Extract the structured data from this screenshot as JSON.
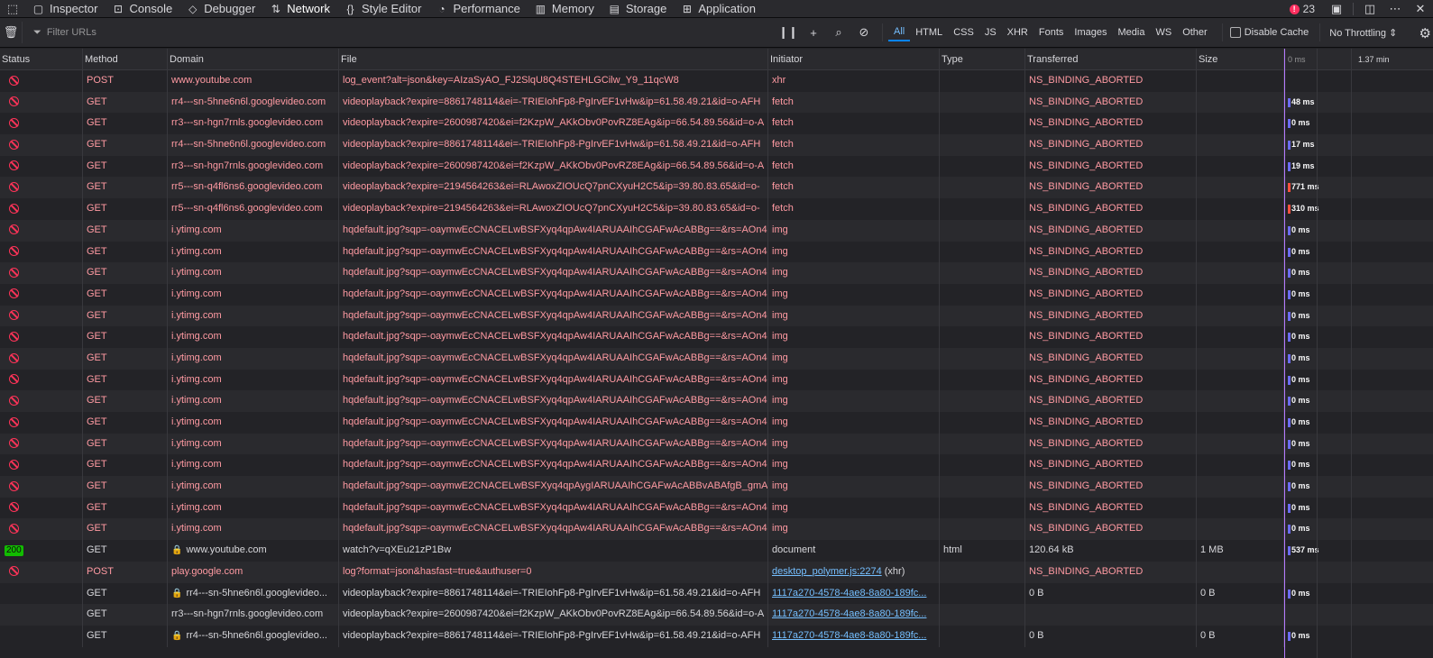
{
  "toolbar": {
    "tabs": [
      {
        "label": "Inspector",
        "icon": "inspector-icon",
        "glyph": "▢"
      },
      {
        "label": "Console",
        "icon": "console-icon",
        "glyph": "⊡"
      },
      {
        "label": "Debugger",
        "icon": "debugger-icon",
        "glyph": "◇"
      },
      {
        "label": "Network",
        "icon": "network-icon",
        "glyph": "⇅"
      },
      {
        "label": "Style Editor",
        "icon": "style-editor-icon",
        "glyph": "{}"
      },
      {
        "label": "Performance",
        "icon": "performance-icon",
        "glyph": "◔"
      },
      {
        "label": "Memory",
        "icon": "memory-icon",
        "glyph": "▥"
      },
      {
        "label": "Storage",
        "icon": "storage-icon",
        "glyph": "▤"
      },
      {
        "label": "Application",
        "icon": "application-icon",
        "glyph": "⊞"
      }
    ],
    "error_count": "23"
  },
  "filter": {
    "placeholder": "Filter URLs",
    "types": [
      "All",
      "HTML",
      "CSS",
      "JS",
      "XHR",
      "Fonts",
      "Images",
      "Media",
      "WS",
      "Other"
    ],
    "active_type": "All",
    "disable_cache_label": "Disable Cache",
    "throttling_label": "No Throttling ⇕"
  },
  "columns": [
    "Status",
    "Method",
    "Domain",
    "File",
    "Initiator",
    "Type",
    "Transferred",
    "Size"
  ],
  "waterfall_header": {
    "start": "0 ms",
    "end": "1.37 min"
  },
  "rows": [
    {
      "status": "blocked",
      "method": "POST",
      "domain": "www.youtube.com",
      "file": "log_event?alt=json&key=AIzaSyAO_FJ2SlqU8Q4STEHLGCilw_Y9_11qcW8",
      "initiator": "xhr",
      "type": "",
      "transferred": "NS_BINDING_ABORTED",
      "size": "",
      "time": ""
    },
    {
      "status": "blocked",
      "method": "GET",
      "domain": "rr4---sn-5hne6n6l.googlevideo.com",
      "file": "videoplayback?expire=8861748114&ei=-TRIEIohFp8-PgIrvEF1vHw&ip=61.58.49.21&id=o-AFH",
      "initiator": "fetch",
      "type": "",
      "transferred": "NS_BINDING_ABORTED",
      "size": "",
      "time": "48 ms"
    },
    {
      "status": "blocked",
      "method": "GET",
      "domain": "rr3---sn-hgn7rnls.googlevideo.com",
      "file": "videoplayback?expire=2600987420&ei=f2KzpW_AKkObv0PovRZ8EAg&ip=66.54.89.56&id=o-A",
      "initiator": "fetch",
      "type": "",
      "transferred": "NS_BINDING_ABORTED",
      "size": "",
      "time": "0 ms"
    },
    {
      "status": "blocked",
      "method": "GET",
      "domain": "rr4---sn-5hne6n6l.googlevideo.com",
      "file": "videoplayback?expire=8861748114&ei=-TRIEIohFp8-PgIrvEF1vHw&ip=61.58.49.21&id=o-AFH",
      "initiator": "fetch",
      "type": "",
      "transferred": "NS_BINDING_ABORTED",
      "size": "",
      "time": "17 ms"
    },
    {
      "status": "blocked",
      "method": "GET",
      "domain": "rr3---sn-hgn7rnls.googlevideo.com",
      "file": "videoplayback?expire=2600987420&ei=f2KzpW_AKkObv0PovRZ8EAg&ip=66.54.89.56&id=o-A",
      "initiator": "fetch",
      "type": "",
      "transferred": "NS_BINDING_ABORTED",
      "size": "",
      "time": "19 ms"
    },
    {
      "status": "blocked",
      "method": "GET",
      "domain": "rr5---sn-q4fl6ns6.googlevideo.com",
      "file": "videoplayback?expire=2194564263&ei=RLAwoxZIOUcQ7pnCXyuH2C5&ip=39.80.83.65&id=o-",
      "initiator": "fetch",
      "type": "",
      "transferred": "NS_BINDING_ABORTED",
      "size": "",
      "time": "771 ms"
    },
    {
      "status": "blocked",
      "method": "GET",
      "domain": "rr5---sn-q4fl6ns6.googlevideo.com",
      "file": "videoplayback?expire=2194564263&ei=RLAwoxZIOUcQ7pnCXyuH2C5&ip=39.80.83.65&id=o-",
      "initiator": "fetch",
      "type": "",
      "transferred": "NS_BINDING_ABORTED",
      "size": "",
      "time": "310 ms"
    },
    {
      "status": "blocked",
      "method": "GET",
      "domain": "i.ytimg.com",
      "file": "hqdefault.jpg?sqp=-oaymwEcCNACELwBSFXyq4qpAw4IARUAAIhCGAFwAcABBg==&rs=AOn4",
      "initiator": "img",
      "type": "",
      "transferred": "NS_BINDING_ABORTED",
      "size": "",
      "time": "0 ms"
    },
    {
      "status": "blocked",
      "method": "GET",
      "domain": "i.ytimg.com",
      "file": "hqdefault.jpg?sqp=-oaymwEcCNACELwBSFXyq4qpAw4IARUAAIhCGAFwAcABBg==&rs=AOn4",
      "initiator": "img",
      "type": "",
      "transferred": "NS_BINDING_ABORTED",
      "size": "",
      "time": "0 ms"
    },
    {
      "status": "blocked",
      "method": "GET",
      "domain": "i.ytimg.com",
      "file": "hqdefault.jpg?sqp=-oaymwEcCNACELwBSFXyq4qpAw4IARUAAIhCGAFwAcABBg==&rs=AOn4",
      "initiator": "img",
      "type": "",
      "transferred": "NS_BINDING_ABORTED",
      "size": "",
      "time": "0 ms"
    },
    {
      "status": "blocked",
      "method": "GET",
      "domain": "i.ytimg.com",
      "file": "hqdefault.jpg?sqp=-oaymwEcCNACELwBSFXyq4qpAw4IARUAAIhCGAFwAcABBg==&rs=AOn4",
      "initiator": "img",
      "type": "",
      "transferred": "NS_BINDING_ABORTED",
      "size": "",
      "time": "0 ms"
    },
    {
      "status": "blocked",
      "method": "GET",
      "domain": "i.ytimg.com",
      "file": "hqdefault.jpg?sqp=-oaymwEcCNACELwBSFXyq4qpAw4IARUAAIhCGAFwAcABBg==&rs=AOn4",
      "initiator": "img",
      "type": "",
      "transferred": "NS_BINDING_ABORTED",
      "size": "",
      "time": "0 ms"
    },
    {
      "status": "blocked",
      "method": "GET",
      "domain": "i.ytimg.com",
      "file": "hqdefault.jpg?sqp=-oaymwEcCNACELwBSFXyq4qpAw4IARUAAIhCGAFwAcABBg==&rs=AOn4",
      "initiator": "img",
      "type": "",
      "transferred": "NS_BINDING_ABORTED",
      "size": "",
      "time": "0 ms"
    },
    {
      "status": "blocked",
      "method": "GET",
      "domain": "i.ytimg.com",
      "file": "hqdefault.jpg?sqp=-oaymwEcCNACELwBSFXyq4qpAw4IARUAAIhCGAFwAcABBg==&rs=AOn4",
      "initiator": "img",
      "type": "",
      "transferred": "NS_BINDING_ABORTED",
      "size": "",
      "time": "0 ms"
    },
    {
      "status": "blocked",
      "method": "GET",
      "domain": "i.ytimg.com",
      "file": "hqdefault.jpg?sqp=-oaymwEcCNACELwBSFXyq4qpAw4IARUAAIhCGAFwAcABBg==&rs=AOn4",
      "initiator": "img",
      "type": "",
      "transferred": "NS_BINDING_ABORTED",
      "size": "",
      "time": "0 ms"
    },
    {
      "status": "blocked",
      "method": "GET",
      "domain": "i.ytimg.com",
      "file": "hqdefault.jpg?sqp=-oaymwEcCNACELwBSFXyq4qpAw4IARUAAIhCGAFwAcABBg==&rs=AOn4",
      "initiator": "img",
      "type": "",
      "transferred": "NS_BINDING_ABORTED",
      "size": "",
      "time": "0 ms"
    },
    {
      "status": "blocked",
      "method": "GET",
      "domain": "i.ytimg.com",
      "file": "hqdefault.jpg?sqp=-oaymwEcCNACELwBSFXyq4qpAw4IARUAAIhCGAFwAcABBg==&rs=AOn4",
      "initiator": "img",
      "type": "",
      "transferred": "NS_BINDING_ABORTED",
      "size": "",
      "time": "0 ms"
    },
    {
      "status": "blocked",
      "method": "GET",
      "domain": "i.ytimg.com",
      "file": "hqdefault.jpg?sqp=-oaymwEcCNACELwBSFXyq4qpAw4IARUAAIhCGAFwAcABBg==&rs=AOn4",
      "initiator": "img",
      "type": "",
      "transferred": "NS_BINDING_ABORTED",
      "size": "",
      "time": "0 ms"
    },
    {
      "status": "blocked",
      "method": "GET",
      "domain": "i.ytimg.com",
      "file": "hqdefault.jpg?sqp=-oaymwEcCNACELwBSFXyq4qpAw4IARUAAIhCGAFwAcABBg==&rs=AOn4",
      "initiator": "img",
      "type": "",
      "transferred": "NS_BINDING_ABORTED",
      "size": "",
      "time": "0 ms"
    },
    {
      "status": "blocked",
      "method": "GET",
      "domain": "i.ytimg.com",
      "file": "hqdefault.jpg?sqp=-oaymwE2CNACELwBSFXyq4qpAygIARUAAIhCGAFwAcABBvABAfgB_gmA",
      "initiator": "img",
      "type": "",
      "transferred": "NS_BINDING_ABORTED",
      "size": "",
      "time": "0 ms"
    },
    {
      "status": "blocked",
      "method": "GET",
      "domain": "i.ytimg.com",
      "file": "hqdefault.jpg?sqp=-oaymwEcCNACELwBSFXyq4qpAw4IARUAAIhCGAFwAcABBg==&rs=AOn4",
      "initiator": "img",
      "type": "",
      "transferred": "NS_BINDING_ABORTED",
      "size": "",
      "time": "0 ms"
    },
    {
      "status": "blocked",
      "method": "GET",
      "domain": "i.ytimg.com",
      "file": "hqdefault.jpg?sqp=-oaymwEcCNACELwBSFXyq4qpAw4IARUAAIhCGAFwAcABBg==&rs=AOn4",
      "initiator": "img",
      "type": "",
      "transferred": "NS_BINDING_ABORTED",
      "size": "",
      "time": "0 ms"
    },
    {
      "status": "200",
      "method": "GET",
      "domain": "www.youtube.com",
      "secure": true,
      "file": "watch?v=qXEu21zP1Bw",
      "initiator": "document",
      "type": "html",
      "transferred": "120.64 kB",
      "size": "1 MB",
      "time": "537 ms"
    },
    {
      "status": "blocked",
      "method": "POST",
      "domain": "play.google.com",
      "file": "log?format=json&hasfast=true&authuser=0",
      "initiator": "desktop_polymer.js:2274",
      "initiator_suffix": " (xhr)",
      "initiator_link": true,
      "type": "",
      "transferred": "NS_BINDING_ABORTED",
      "size": "",
      "time": ""
    },
    {
      "status": "",
      "method": "GET",
      "domain": "rr4---sn-5hne6n6l.googlevideo...",
      "secure": true,
      "file": "videoplayback?expire=8861748114&ei=-TRIEIohFp8-PgIrvEF1vHw&ip=61.58.49.21&id=o-AFH",
      "initiator": "1117a270-4578-4ae8-8a80-189fc...",
      "initiator_link": true,
      "type": "",
      "transferred": "0 B",
      "size": "0 B",
      "time": "0 ms"
    },
    {
      "status": "",
      "method": "GET",
      "domain": "rr3---sn-hgn7rnls.googlevideo.com",
      "file": "videoplayback?expire=2600987420&ei=f2KzpW_AKkObv0PovRZ8EAg&ip=66.54.89.56&id=o-A",
      "initiator": "1117a270-4578-4ae8-8a80-189fc...",
      "initiator_link": true,
      "type": "",
      "transferred": "",
      "size": "",
      "time": ""
    },
    {
      "status": "",
      "method": "GET",
      "domain": "rr4---sn-5hne6n6l.googlevideo...",
      "secure": true,
      "file": "videoplayback?expire=8861748114&ei=-TRIEIohFp8-PgIrvEF1vHw&ip=61.58.49.21&id=o-AFH",
      "initiator": "1117a270-4578-4ae8-8a80-189fc...",
      "initiator_link": true,
      "type": "",
      "transferred": "0 B",
      "size": "0 B",
      "time": "0 ms"
    }
  ]
}
